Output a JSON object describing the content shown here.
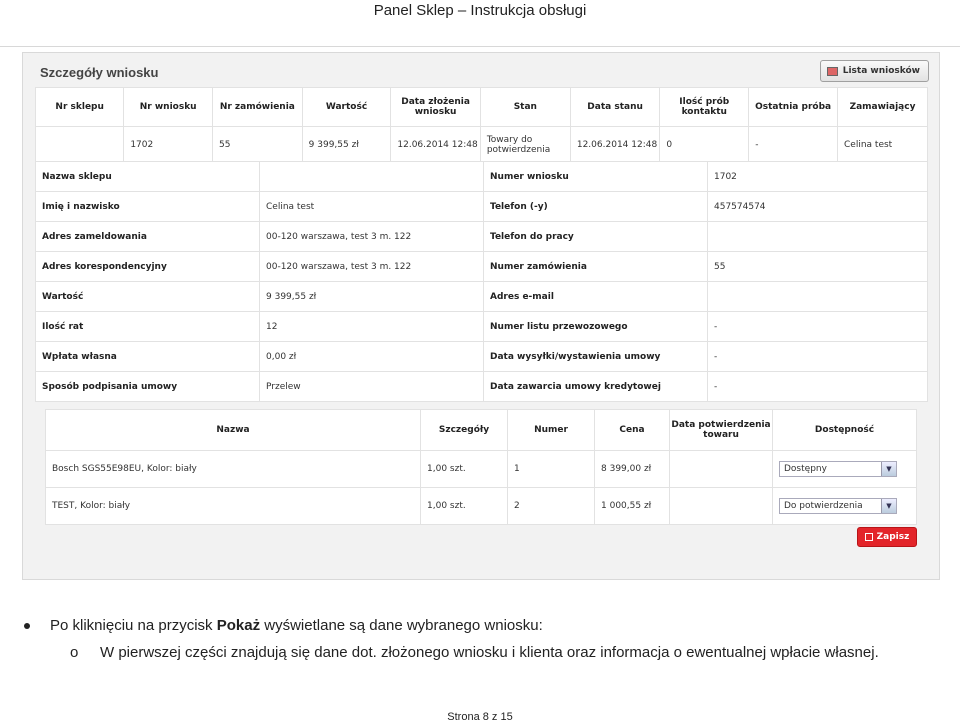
{
  "doc": {
    "header": "Panel Sklep – Instrukcja obsługi",
    "footer": "Strona 8 z 15"
  },
  "panel": {
    "title": "Szczegóły wniosku",
    "list_button": "Lista wniosków",
    "save_button": "Zapisz"
  },
  "summary": {
    "headers": [
      "Nr sklepu",
      "Nr wniosku",
      "Nr zamówienia",
      "Wartość",
      "Data złożenia wniosku",
      "Stan",
      "Data stanu",
      "Ilość prób kontaktu",
      "Ostatnia próba",
      "Zamawiający"
    ],
    "row": [
      "1702",
      "55",
      "9 399,55 zł",
      "12.06.2014 12:48",
      "Towary do potwierdzenia",
      "12.06.2014 12:48",
      "0",
      "-",
      "Celina   test"
    ]
  },
  "details": [
    [
      "Nazwa sklepu",
      "",
      "Numer wniosku",
      "1702"
    ],
    [
      "Imię i nazwisko",
      "Celina test",
      "Telefon (-y)",
      "457574574"
    ],
    [
      "Adres zameldowania",
      "00-120 warszawa, test 3 m. 122",
      "Telefon do pracy",
      ""
    ],
    [
      "Adres korespondencyjny",
      "00-120 warszawa, test 3 m. 122",
      "Numer zamówienia",
      "55"
    ],
    [
      "Wartość",
      "9 399,55 zł",
      "Adres e-mail",
      ""
    ],
    [
      "Ilość rat",
      "12",
      "Numer listu przewozowego",
      "-"
    ],
    [
      "Wpłata własna",
      "0,00 zł",
      "Data wysyłki/wystawienia umowy",
      "-"
    ],
    [
      "Sposób podpisania umowy",
      "Przelew",
      "Data zawarcia umowy kredytowej",
      "-"
    ]
  ],
  "products": {
    "headers": [
      "Nazwa",
      "Szczegóły",
      "Numer",
      "Cena",
      "Data potwierdzenia towaru",
      "Dostępność"
    ],
    "rows": [
      {
        "name": "Bosch SGS55E98EU, Kolor: biały",
        "qty": "1,00 szt.",
        "num": "1",
        "price": "8 399,00 zł",
        "date": "",
        "avail": "Dostępny"
      },
      {
        "name": "TEST, Kolor: biały",
        "qty": "1,00 szt.",
        "num": "2",
        "price": "1 000,55 zł",
        "date": "",
        "avail": "Do potwierdzenia"
      }
    ]
  },
  "text": {
    "bullet1_a": "Po kliknięciu na przycisk ",
    "bullet1_b": "Pokaż",
    "bullet1_c": " wyświetlane są dane wybranego wniosku:",
    "sub_marker": "o",
    "bullet2": "W pierwszej części znajdują się dane dot. złożonego wniosku i klienta oraz informacja o ewentualnej wpłacie własnej."
  },
  "icons": {
    "list": "list-icon",
    "save": "save-icon",
    "dropdown": "chevron-down-icon"
  }
}
